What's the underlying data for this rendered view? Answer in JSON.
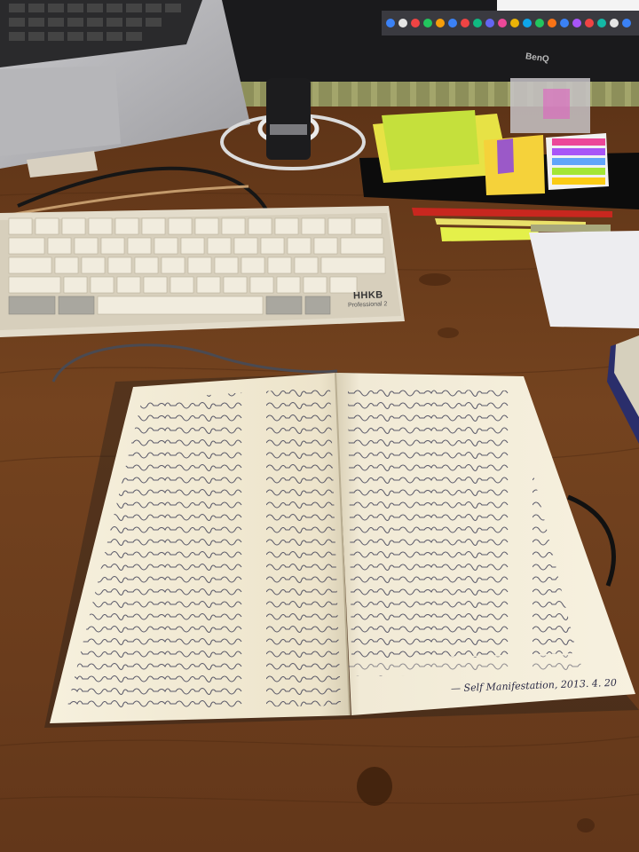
{
  "keyboard": {
    "brand": "HHKB",
    "model": "Professional 2"
  },
  "monitor": {
    "brand": "BenQ"
  },
  "notebook": {
    "signature": "— Self Manifestation, 2013. 4. 20"
  },
  "colors": {
    "desk": "#6b3c1c",
    "paper": "#f3ecd8",
    "ink": "#2b2d48",
    "sticky_green": "#c5e03c",
    "sticky_yellow": "#f5d23a",
    "sticky_purple": "#9b59c8",
    "pen_red": "#c8271f",
    "highlighter": "#e4f04a"
  }
}
